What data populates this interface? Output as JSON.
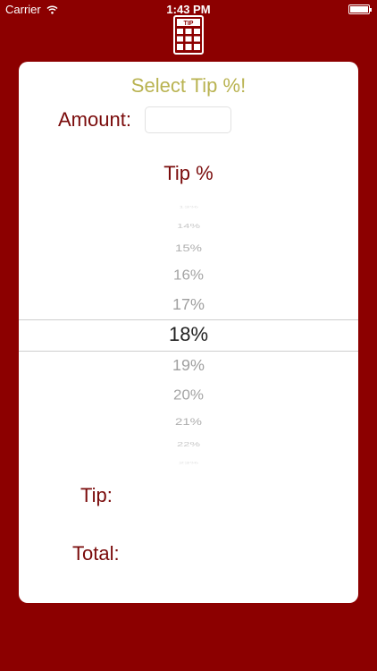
{
  "status_bar": {
    "carrier": "Carrier",
    "time": "1:43 PM",
    "icons": [
      "wifi-icon",
      "battery-icon"
    ]
  },
  "app": {
    "logo_icon": "tip-card-icon",
    "logo_text": "TIP"
  },
  "card": {
    "title": "Select Tip %!",
    "amount_label": "Amount:",
    "amount_value": "",
    "tip_heading": "Tip %",
    "picker": {
      "options": [
        "13%",
        "14%",
        "15%",
        "16%",
        "17%",
        "18%",
        "19%",
        "20%",
        "21%",
        "22%",
        "23%"
      ],
      "selected": "18%"
    },
    "tip_label": "Tip:",
    "total_label": "Total:"
  },
  "colors": {
    "background": "#8c0000",
    "title": "#b9b351",
    "label": "#7a0b0b",
    "card": "#ffffff"
  }
}
